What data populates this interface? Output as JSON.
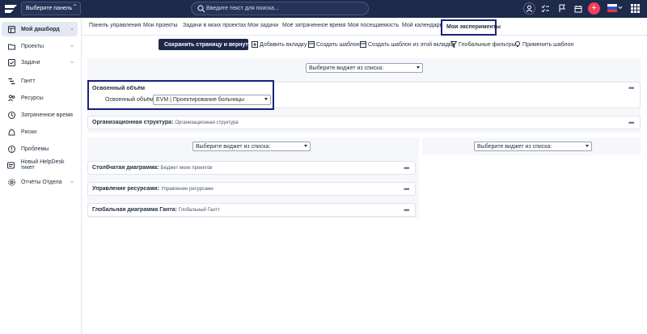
{
  "topbar": {
    "panel_select": "Выберите панель",
    "search_placeholder": "Введите текст для поиска..."
  },
  "sidebar": {
    "items": [
      {
        "label": "Мой дашборд",
        "icon": "dashboard-icon",
        "active": true,
        "has_chevron": true
      },
      {
        "label": "Проекты",
        "icon": "folder-icon",
        "has_chevron": true
      },
      {
        "label": "Задачи",
        "icon": "tasks-icon",
        "has_chevron": true
      },
      {
        "label": "Гантт",
        "icon": "gantt-icon"
      },
      {
        "label": "Ресурсы",
        "icon": "resources-icon"
      },
      {
        "label": "Затраченное время",
        "icon": "clock-icon"
      },
      {
        "label": "Риски",
        "icon": "risk-icon"
      },
      {
        "label": "Проблемы",
        "icon": "problem-icon"
      },
      {
        "label": "Новый HelpDesk тикет",
        "icon": "helpdesk-icon"
      },
      {
        "label": "Отчёты Отдела",
        "icon": "reports-icon",
        "has_chevron": true
      }
    ]
  },
  "tabs": [
    "Панель управления",
    "Мои проекты",
    "Задачи в моих проектах",
    "Мои задачи",
    "Моё затраченное время",
    "Моя посещаемость",
    "Мой календарь",
    "Мои эксперименты"
  ],
  "toolbar": {
    "save_return": "Сохранить страницу и вернуться",
    "add_tab": "Добавить вкладку",
    "create_template": "Создать шаблон",
    "create_template_from_tab": "Создать шаблон из этой вкладки",
    "global_filters": "Глобальные фильтры",
    "apply_template": "Применить шаблон"
  },
  "widgets": {
    "select_widget": "Выберите виджет из списка:",
    "evm": {
      "title": "Освоенный объём",
      "field_label": "Освоенный объём:",
      "field_value": "EVM | Проектирование больницы"
    },
    "org_structure": {
      "title": "Организационная структура:",
      "sub": "Организационная структура"
    },
    "bar_chart": {
      "title": "Столбчатая диаграмма:",
      "sub": "Бюджет моих проектов"
    },
    "resource_mgmt": {
      "title": "Управление ресурсами:",
      "sub": "Управление ресурсами"
    },
    "global_gantt": {
      "title": "Глобальная диаграмма Ганта:",
      "sub": "Глобальный Гантт"
    }
  },
  "colors": {
    "topbar_bg": "#1e2a4a",
    "accent_red": "#f0405c",
    "highlight_border": "#1a237e"
  }
}
